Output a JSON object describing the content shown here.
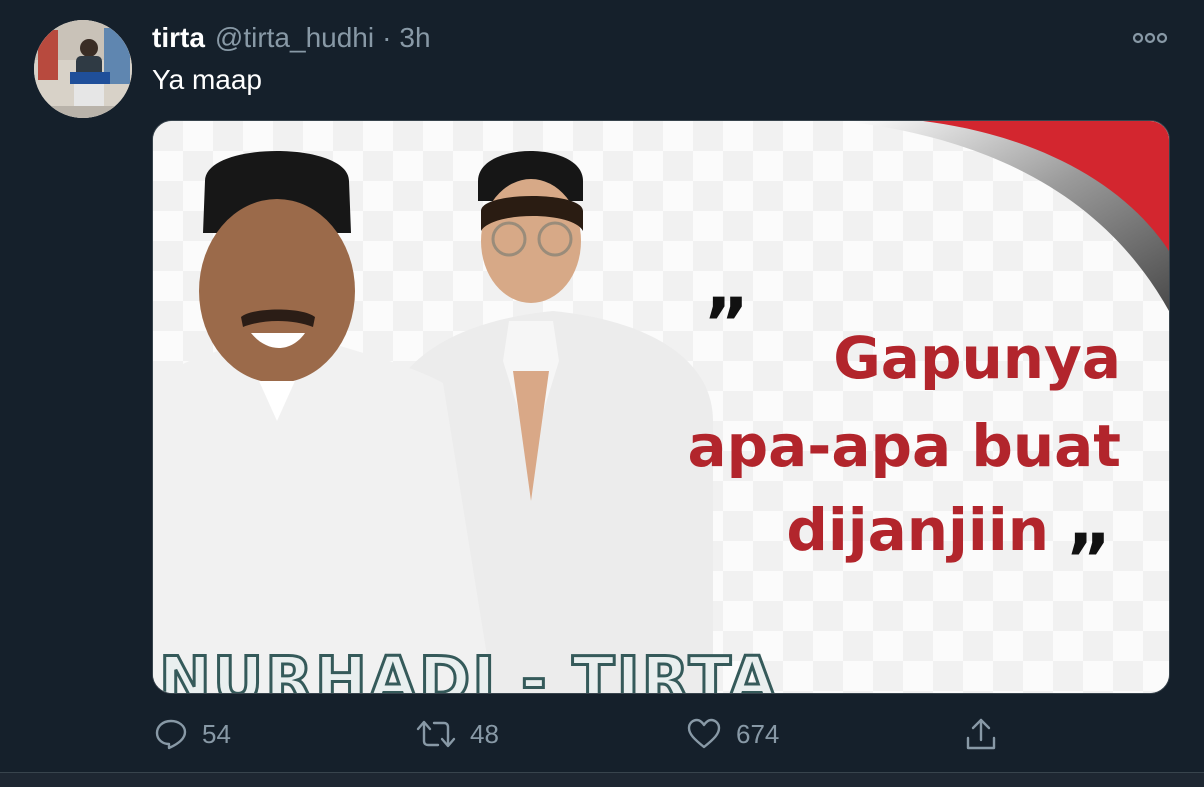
{
  "tweet": {
    "author_name": "tirta",
    "author_handle": "@tirta_hudhi",
    "separator": "·",
    "time": "3h",
    "text": "Ya maap",
    "image": {
      "quote_open": "”",
      "quote_lines": [
        "Gapunya",
        "apa-apa buat",
        "dijanjiin"
      ],
      "quote_close": "”",
      "banner": "NURHADI - TIRTA"
    },
    "actions": {
      "reply_count": "54",
      "retweet_count": "48",
      "like_count": "674"
    }
  },
  "colors": {
    "background": "#15202b",
    "secondary_text": "#8899a6",
    "quote_red": "#b2252c"
  },
  "icons": [
    "more-icon",
    "reply-icon",
    "retweet-icon",
    "like-icon",
    "share-icon"
  ]
}
